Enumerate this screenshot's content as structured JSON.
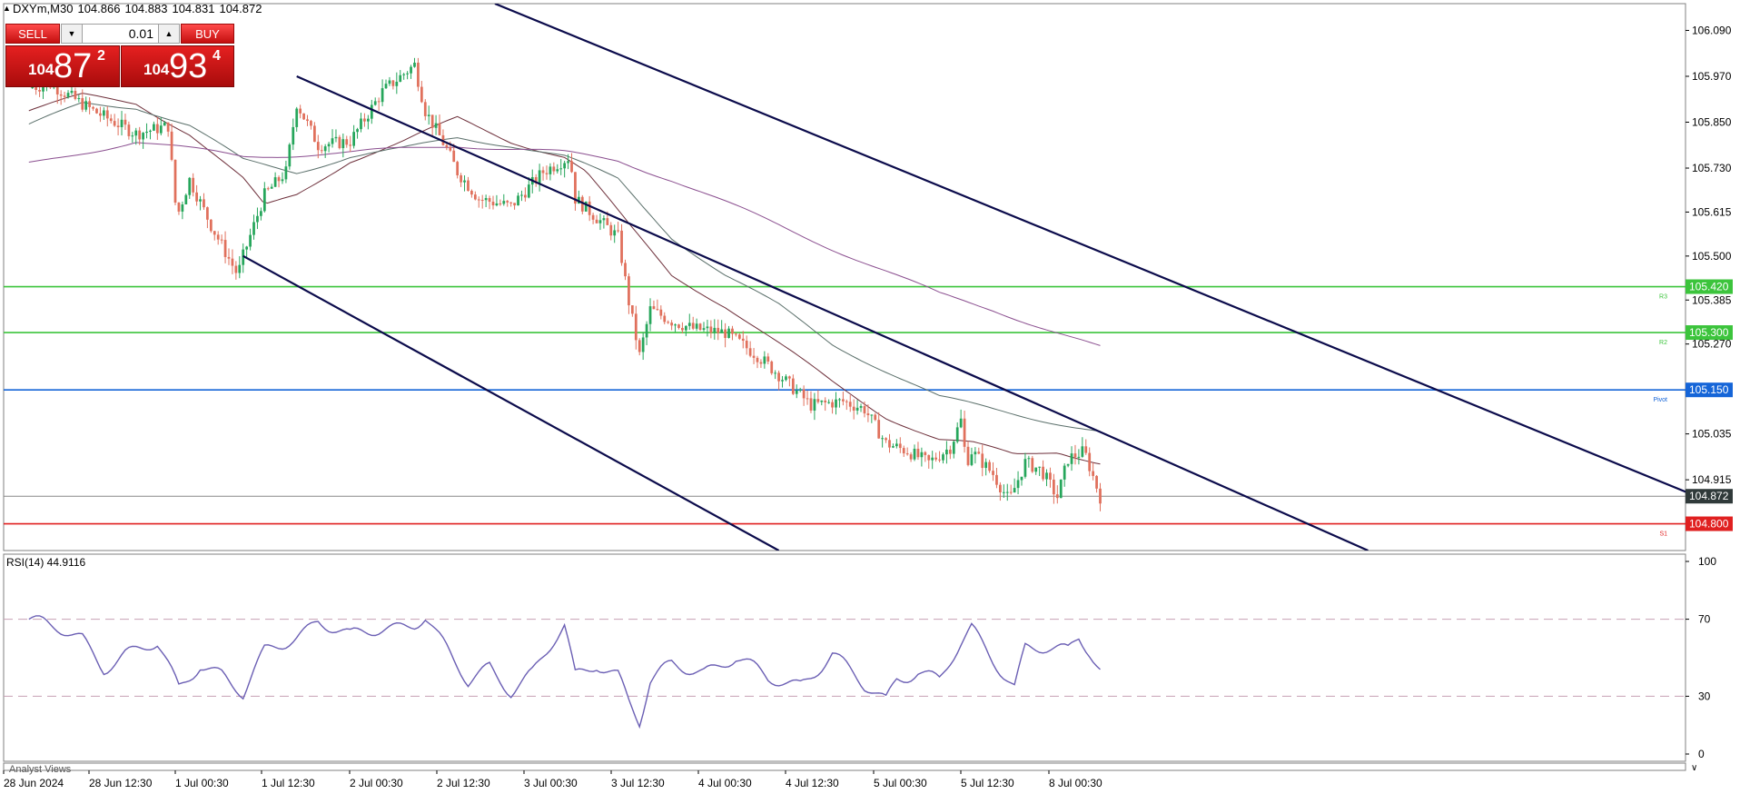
{
  "header": {
    "symbol": "DXYm,M30",
    "open": "104.866",
    "high": "104.883",
    "low": "104.831",
    "close": "104.872"
  },
  "trade_panel": {
    "sell_label": "SELL",
    "buy_label": "BUY",
    "volume": "0.01",
    "sell_price": {
      "small": "104",
      "big": "87",
      "sup": "2"
    },
    "buy_price": {
      "small": "104",
      "big": "93",
      "sup": "4"
    }
  },
  "rsi_panel": {
    "label": "RSI(14) 44.9116"
  },
  "subwindow_label": "Analyst Views",
  "colors": {
    "bull": "#26a65b",
    "bear": "#e0705c",
    "channel": "#0b0b4b",
    "resistance": "#3cc43c",
    "pivot": "#1565d8",
    "support": "#e02020",
    "rsi": "#6b5fb4"
  },
  "chart_data": [
    {
      "type": "candlestick",
      "timeframe": "M30",
      "y_ticks": [
        "106.090",
        "105.970",
        "105.850",
        "105.730",
        "105.615",
        "105.500",
        "105.385",
        "105.270",
        "105.035",
        "104.915"
      ],
      "ylim": [
        104.73,
        106.16
      ],
      "x_ticks": [
        "28 Jun 2024",
        "28 Jun 12:30",
        "1 Jul 00:30",
        "1 Jul 12:30",
        "2 Jul 00:30",
        "2 Jul 12:30",
        "3 Jul 00:30",
        "3 Jul 12:30",
        "4 Jul 00:30",
        "4 Jul 12:30",
        "5 Jul 00:30",
        "5 Jul 12:30",
        "8 Jul 00:30"
      ],
      "levels": [
        {
          "label": "R3",
          "price": "105.420",
          "value": 105.42,
          "color": "#3cc43c"
        },
        {
          "label": "R2",
          "price": "105.300",
          "value": 105.3,
          "color": "#3cc43c"
        },
        {
          "label": "Pivot",
          "price": "105.150",
          "value": 105.15,
          "color": "#1565d8"
        },
        {
          "label": "S1",
          "price": "104.800",
          "value": 104.8,
          "color": "#e02020"
        }
      ],
      "current_price": {
        "label": "104.872",
        "value": 104.872
      },
      "path_t": [
        0,
        0.02,
        0.06,
        0.1,
        0.13,
        0.138,
        0.15,
        0.17,
        0.195,
        0.2,
        0.22,
        0.24,
        0.25,
        0.27,
        0.3,
        0.33,
        0.36,
        0.37,
        0.39,
        0.4,
        0.42,
        0.45,
        0.48,
        0.505,
        0.51,
        0.53,
        0.55,
        0.56,
        0.57,
        0.58,
        0.6,
        0.62,
        0.65,
        0.68,
        0.7,
        0.73,
        0.76,
        0.78,
        0.8,
        0.82,
        0.84,
        0.86,
        0.87,
        0.875,
        0.88,
        0.9,
        0.915,
        0.93,
        0.945,
        0.96,
        0.97,
        0.985,
        1.0
      ],
      "path_p": [
        105.94,
        105.95,
        105.88,
        105.82,
        105.84,
        105.6,
        105.7,
        105.58,
        105.45,
        105.5,
        105.66,
        105.72,
        105.9,
        105.79,
        105.8,
        105.93,
        106.0,
        105.88,
        105.78,
        105.72,
        105.65,
        105.63,
        105.72,
        105.76,
        105.65,
        105.6,
        105.55,
        105.38,
        105.24,
        105.36,
        105.33,
        105.31,
        105.3,
        105.24,
        105.19,
        105.11,
        105.12,
        105.1,
        105.01,
        104.99,
        104.96,
        105.0,
        105.07,
        104.96,
        104.99,
        104.93,
        104.86,
        104.96,
        104.94,
        104.87,
        104.97,
        104.99,
        104.87
      ],
      "ma_paths": [
        {
          "t": [
            0,
            0.05,
            0.1,
            0.15,
            0.2,
            0.22,
            0.25,
            0.3,
            0.35,
            0.4,
            0.45,
            0.5,
            0.52,
            0.56,
            0.6,
            0.65,
            0.7,
            0.75,
            0.8,
            0.85,
            0.88,
            0.92,
            0.96,
            1.0
          ],
          "p": [
            105.88,
            105.92,
            105.9,
            105.82,
            105.7,
            105.63,
            105.66,
            105.75,
            105.8,
            105.86,
            105.8,
            105.76,
            105.72,
            105.58,
            105.45,
            105.37,
            105.27,
            105.17,
            105.08,
            105.02,
            105.01,
            104.98,
            104.99,
            104.96
          ]
        },
        {
          "t": [
            0,
            0.05,
            0.1,
            0.15,
            0.2,
            0.25,
            0.3,
            0.35,
            0.4,
            0.45,
            0.5,
            0.55,
            0.6,
            0.65,
            0.7,
            0.75,
            0.8,
            0.85,
            0.9,
            0.95,
            1.0
          ],
          "p": [
            105.84,
            105.9,
            105.89,
            105.84,
            105.75,
            105.72,
            105.76,
            105.78,
            105.81,
            105.79,
            105.76,
            105.7,
            105.55,
            105.45,
            105.37,
            105.27,
            105.2,
            105.13,
            105.1,
            105.07,
            105.04
          ]
        },
        {
          "t": [
            0,
            0.1,
            0.2,
            0.3,
            0.4,
            0.5,
            0.55,
            0.6,
            0.65,
            0.7,
            0.75,
            0.8,
            0.85,
            0.9,
            0.95,
            1.0
          ],
          "p": [
            105.74,
            105.8,
            105.76,
            105.77,
            105.79,
            105.77,
            105.75,
            105.7,
            105.64,
            105.58,
            105.52,
            105.46,
            105.4,
            105.36,
            105.31,
            105.26
          ]
        }
      ],
      "channels": [
        {
          "t0": 0.435,
          "p0": 106.16,
          "t1": 1.68,
          "p1": 104.73
        },
        {
          "t0": 0.25,
          "p0": 105.97,
          "t1": 1.25,
          "p1": 104.73
        },
        {
          "t0": 0.2,
          "p0": 105.5,
          "t1": 0.7,
          "p1": 104.73
        }
      ]
    },
    {
      "type": "line",
      "title": "RSI(14) 44.9116",
      "ylim": [
        0,
        100
      ],
      "y_ticks": [
        "100",
        "70",
        "30",
        "0"
      ],
      "levels": [
        70,
        30
      ],
      "path_t": [
        0,
        0.02,
        0.05,
        0.07,
        0.09,
        0.12,
        0.14,
        0.16,
        0.18,
        0.2,
        0.22,
        0.25,
        0.27,
        0.3,
        0.33,
        0.36,
        0.37,
        0.38,
        0.41,
        0.43,
        0.45,
        0.47,
        0.5,
        0.51,
        0.53,
        0.55,
        0.56,
        0.57,
        0.58,
        0.6,
        0.63,
        0.66,
        0.69,
        0.72,
        0.75,
        0.78,
        0.8,
        0.81,
        0.83,
        0.85,
        0.87,
        0.88,
        0.9,
        0.92,
        0.93,
        0.95,
        0.97,
        0.98,
        0.99,
        1.0
      ],
      "path_v": [
        70,
        65,
        60,
        46,
        52,
        56,
        34,
        48,
        42,
        30,
        52,
        62,
        70,
        60,
        65,
        69,
        72,
        62,
        36,
        46,
        34,
        42,
        65,
        40,
        48,
        42,
        28,
        16,
        36,
        46,
        44,
        50,
        38,
        37,
        52,
        34,
        28,
        40,
        44,
        38,
        56,
        64,
        50,
        36,
        56,
        54,
        52,
        60,
        54,
        45
      ]
    }
  ]
}
